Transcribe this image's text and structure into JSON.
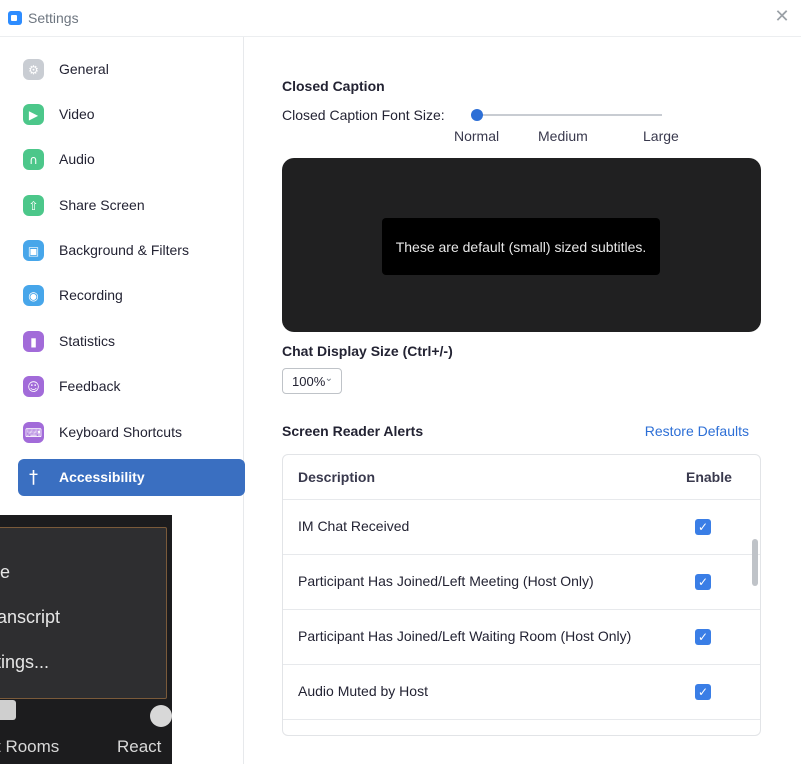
{
  "window": {
    "title": "Settings",
    "close_glyph": "✕"
  },
  "sidebar": {
    "items": [
      {
        "label": "General",
        "icon": "gear-icon",
        "color": "#c9cdd3",
        "glyph": "⚙"
      },
      {
        "label": "Video",
        "icon": "video-icon",
        "color": "#4cc78a",
        "glyph": "▶"
      },
      {
        "label": "Audio",
        "icon": "headphones-icon",
        "color": "#4cc78a",
        "glyph": "∩"
      },
      {
        "label": "Share Screen",
        "icon": "share-screen-icon",
        "color": "#4cc78a",
        "glyph": "⇧"
      },
      {
        "label": "Background & Filters",
        "icon": "background-icon",
        "color": "#47a6ea",
        "glyph": "▣"
      },
      {
        "label": "Recording",
        "icon": "recording-icon",
        "color": "#47a6ea",
        "glyph": "◉"
      },
      {
        "label": "Statistics",
        "icon": "statistics-icon",
        "color": "#a26bd9",
        "glyph": "▮"
      },
      {
        "label": "Feedback",
        "icon": "feedback-icon",
        "color": "#a26bd9",
        "glyph": "☺"
      },
      {
        "label": "Keyboard Shortcuts",
        "icon": "keyboard-icon",
        "color": "#a26bd9",
        "glyph": "⌨"
      },
      {
        "label": "Accessibility",
        "icon": "accessibility-icon",
        "color": "#3a6fc1",
        "glyph": "†",
        "active": true
      }
    ]
  },
  "overlay": {
    "items": [
      "tle",
      "ranscript",
      "ttings..."
    ],
    "bar_labels": [
      "t Rooms",
      "React"
    ]
  },
  "closed_caption": {
    "heading": "Closed Caption",
    "font_size_label": "Closed Caption Font Size:",
    "slider_value_fraction": 0.0,
    "ticks": [
      "Normal",
      "Medium",
      "Large"
    ],
    "preview_text": "These are default (small) sized subtitles."
  },
  "chat_display": {
    "heading": "Chat Display Size (Ctrl+/-)",
    "selected": "100%",
    "chevron": "⌄"
  },
  "screen_reader": {
    "heading": "Screen Reader Alerts",
    "restore_label": "Restore Defaults",
    "columns": [
      "Description",
      "Enable"
    ],
    "rows": [
      {
        "description": "IM Chat Received",
        "enabled": true
      },
      {
        "description": "Participant Has Joined/Left Meeting (Host Only)",
        "enabled": true
      },
      {
        "description": "Participant Has Joined/Left Waiting Room (Host Only)",
        "enabled": true
      },
      {
        "description": "Audio Muted by Host",
        "enabled": true
      }
    ],
    "check_glyph": "✓"
  },
  "colors": {
    "accent": "#2d6fd6",
    "active_nav": "#3a6fc1",
    "checkbox": "#3a7ee6"
  }
}
